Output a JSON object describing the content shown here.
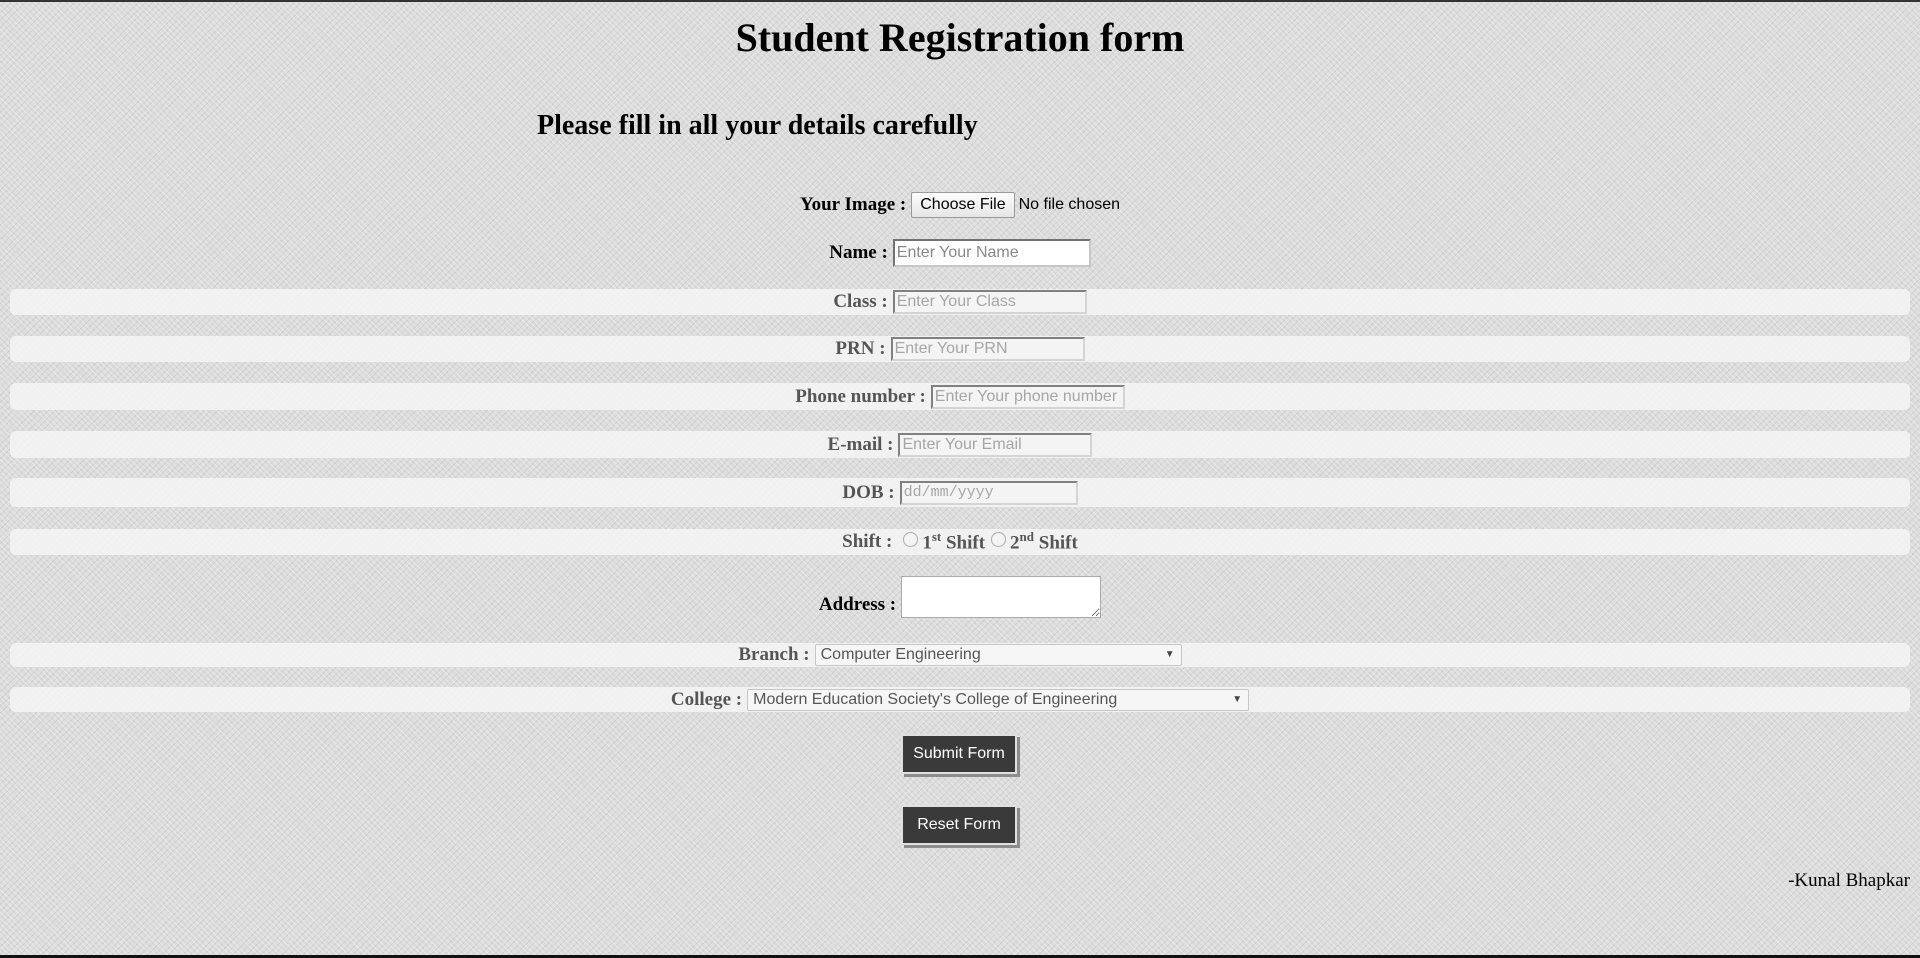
{
  "page": {
    "title": "Student Registration form",
    "subtitle": "Please fill in all your details carefully",
    "credit": "-Kunal Bhapkar"
  },
  "form": {
    "image": {
      "label": "Your Image :",
      "button": "Choose File",
      "status": "No file chosen"
    },
    "name": {
      "label": "Name :",
      "placeholder": "Enter Your Name"
    },
    "class": {
      "label": "Class :",
      "placeholder": "Enter Your Class"
    },
    "prn": {
      "label": "PRN :",
      "placeholder": "Enter Your PRN"
    },
    "phone": {
      "label": "Phone number :",
      "placeholder": "Enter Your phone number"
    },
    "email": {
      "label": "E-mail :",
      "placeholder": "Enter Your Email"
    },
    "dob": {
      "label": "DOB :",
      "placeholder": "dd/mm/yyyy"
    },
    "shift": {
      "label": "Shift :",
      "options": [
        {
          "num": "1",
          "sup": "st",
          "text": "Shift"
        },
        {
          "num": "2",
          "sup": "nd",
          "text": "Shift"
        }
      ]
    },
    "address": {
      "label": "Address :"
    },
    "branch": {
      "label": "Branch :",
      "selected": "Computer Engineering"
    },
    "college": {
      "label": "College :",
      "selected": "Modern Education Society's College of Engineering"
    },
    "submit_label": "Submit Form",
    "reset_label": "Reset Form"
  },
  "icons": {
    "dropdown": "triangle-down-icon",
    "radio": "radio-unchecked-icon"
  },
  "colors": {
    "button_bg": "#3a3a3a",
    "button_text": "#ffffff"
  }
}
